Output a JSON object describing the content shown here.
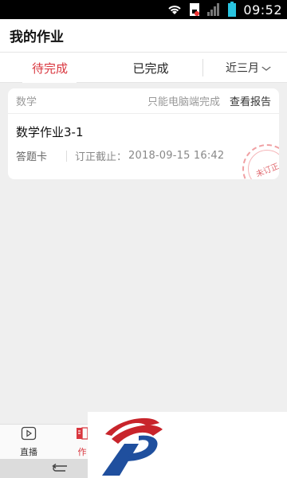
{
  "status": {
    "time": "09:52"
  },
  "header": {
    "title": "我的作业"
  },
  "tabs": {
    "pending": "待完成",
    "done": "已完成",
    "range": "近三月"
  },
  "card": {
    "subject": "数学",
    "pc_only": "只能电脑端完成",
    "view_report": "查看报告",
    "title": "数学作业3-1",
    "answer_card": "答题卡",
    "deadline_label": "订正截止：",
    "deadline_value": "2018-09-15  16:42",
    "stamp": "未订正"
  },
  "bottom_nav": {
    "live": "直播",
    "homework": "作"
  },
  "colors": {
    "accent": "#d9363e",
    "background": "#efefef"
  }
}
